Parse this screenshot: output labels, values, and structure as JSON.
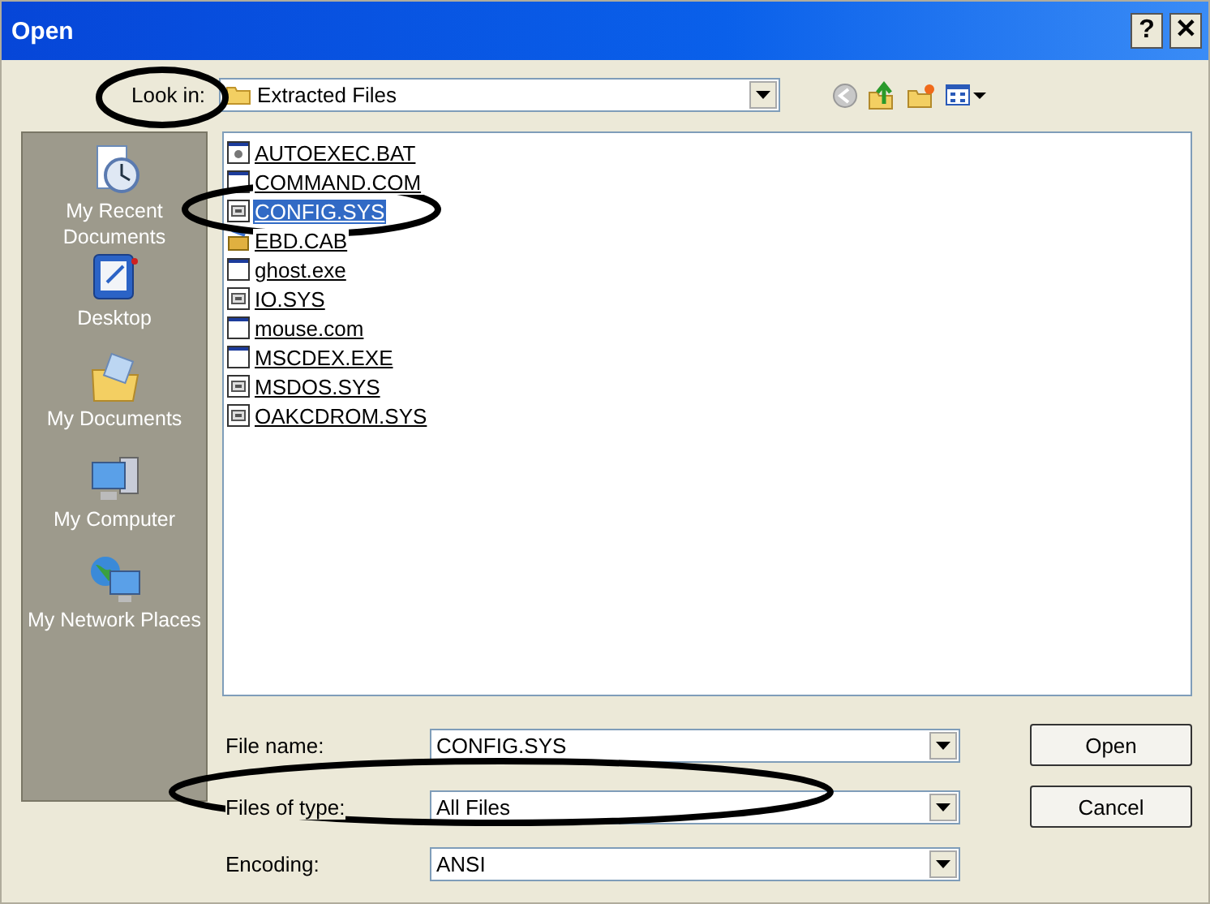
{
  "window": {
    "title": "Open",
    "buttons": [
      "?",
      "✕"
    ]
  },
  "look_in": {
    "label": "Look in:",
    "value": "Extracted Files"
  },
  "sidebar": {
    "items": [
      {
        "kind": "recent",
        "label": "My Recent Documents"
      },
      {
        "kind": "desktop",
        "label": "Desktop"
      },
      {
        "kind": "documents",
        "label": "My Documents"
      },
      {
        "kind": "computer",
        "label": "My Computer"
      },
      {
        "kind": "network",
        "label": "My Network Places"
      }
    ]
  },
  "files": [
    {
      "kind": "bat",
      "name": "AUTOEXEC.BAT",
      "selected": false
    },
    {
      "kind": "exe",
      "name": "COMMAND.COM",
      "selected": false
    },
    {
      "kind": "sys",
      "name": "CONFIG.SYS",
      "selected": true
    },
    {
      "kind": "cab",
      "name": "EBD.CAB",
      "selected": false
    },
    {
      "kind": "exe",
      "name": "ghost.exe",
      "selected": false
    },
    {
      "kind": "sys",
      "name": "IO.SYS",
      "selected": false
    },
    {
      "kind": "exe",
      "name": "mouse.com",
      "selected": false
    },
    {
      "kind": "exe",
      "name": "MSCDEX.EXE",
      "selected": false
    },
    {
      "kind": "sys",
      "name": "MSDOS.SYS",
      "selected": false
    },
    {
      "kind": "sys",
      "name": "OAKCDROM.SYS",
      "selected": false
    }
  ],
  "fields": [
    {
      "label": "File name:",
      "value": "CONFIG.SYS"
    },
    {
      "label": "Files of type:",
      "value": "All Files"
    },
    {
      "label": "Encoding:",
      "value": "ANSI"
    }
  ],
  "buttons": [
    "Open",
    "Cancel"
  ]
}
